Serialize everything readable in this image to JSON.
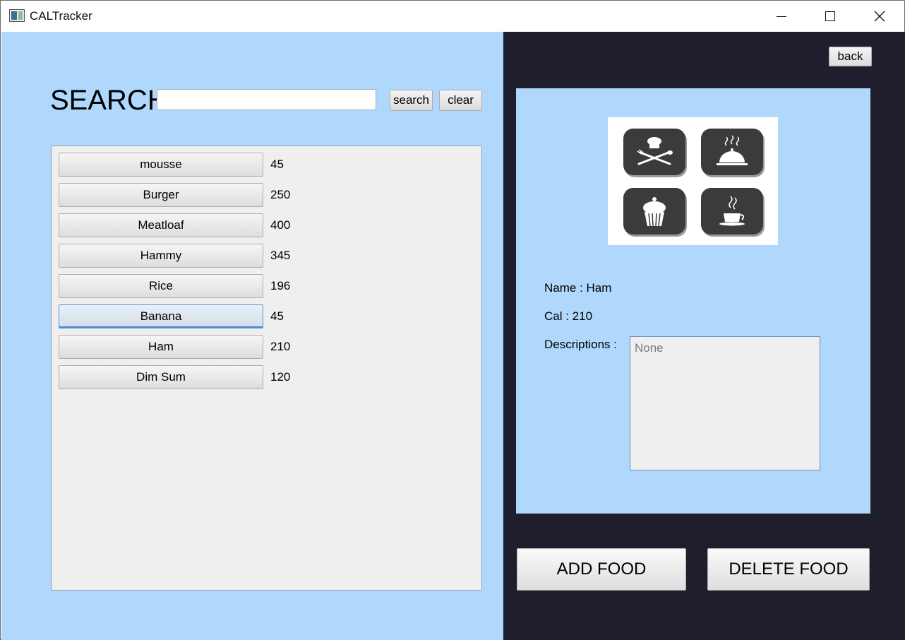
{
  "window": {
    "title": "CALTracker"
  },
  "search": {
    "label": "SEARCH",
    "input_value": "",
    "search_button": "search",
    "clear_button": "clear"
  },
  "food_list": [
    {
      "name": "mousse",
      "cal": "45",
      "selected": false
    },
    {
      "name": "Burger",
      "cal": "250",
      "selected": false
    },
    {
      "name": "Meatloaf",
      "cal": "400",
      "selected": false
    },
    {
      "name": "Hammy",
      "cal": "345",
      "selected": false
    },
    {
      "name": "Rice",
      "cal": "196",
      "selected": false
    },
    {
      "name": "Banana",
      "cal": "45",
      "selected": true
    },
    {
      "name": "Ham",
      "cal": "210",
      "selected": false
    },
    {
      "name": "Dim Sum",
      "cal": "120",
      "selected": false
    }
  ],
  "detail": {
    "back_button": "back",
    "image_icons": [
      "chef-utensils-icon",
      "cloche-icon",
      "cupcake-icon",
      "coffee-cup-icon"
    ],
    "name_text": "Name : Ham",
    "cal_text": "Cal : 210",
    "descriptions_label": "Descriptions :",
    "descriptions_value": "None"
  },
  "actions": {
    "add_food": "ADD FOOD",
    "delete_food": "DELETE FOOD"
  }
}
